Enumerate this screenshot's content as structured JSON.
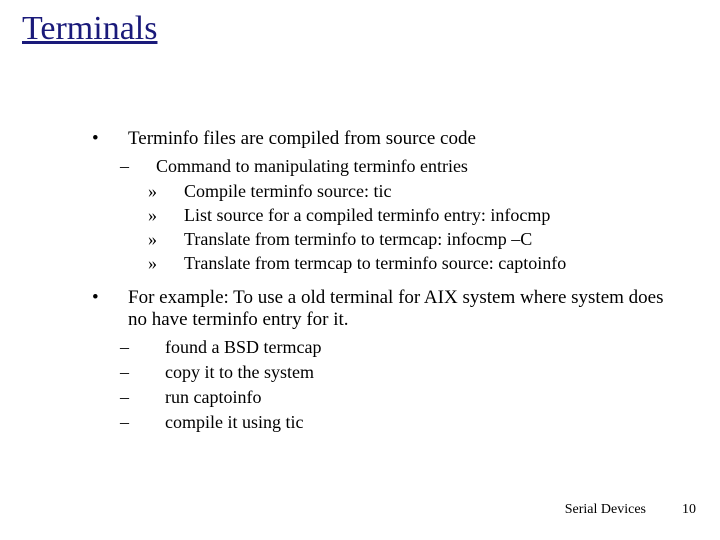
{
  "title": "Terminals",
  "bullets": {
    "b1": "Terminfo files are compiled from source code",
    "b1_1": "Command to manipulating terminfo entries",
    "b1_1_1": "Compile terminfo source: tic",
    "b1_1_2": "List source for a compiled terminfo entry: infocmp",
    "b1_1_3": "Translate from terminfo to termcap: infocmp –C",
    "b1_1_4": "Translate from termcap to terminfo source: captoinfo",
    "b2": "For example: To use a old terminal for AIX system where system does no have terminfo entry for it.",
    "b2_1": "found a BSD termcap",
    "b2_2": "copy it to the system",
    "b2_3": "run captoinfo",
    "b2_4": "compile it using tic"
  },
  "footer": {
    "label": "Serial Devices",
    "page": "10"
  }
}
